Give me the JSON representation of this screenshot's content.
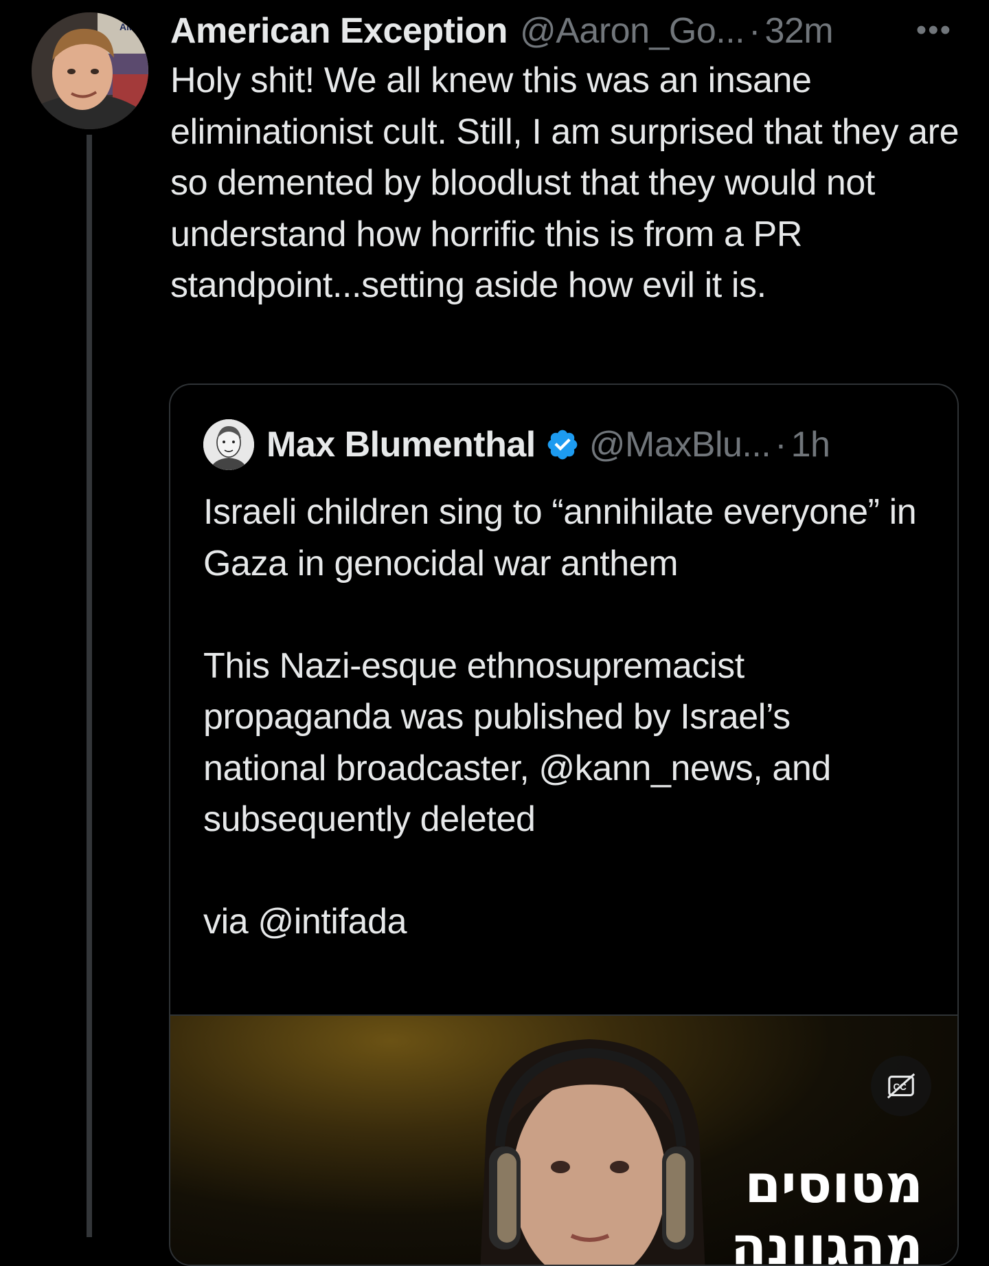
{
  "post": {
    "author_name": "American Exception",
    "author_handle": "@Aaron_Go...",
    "separator": "·",
    "timestamp": "32m",
    "more_label": "•••",
    "text": "Holy shit! We all knew this was an insane eliminationist cult. Still, I am surprised that they are so demented by bloodlust that they would not understand how horrific this is from a PR standpoint...setting aside how evil it is.",
    "avatar_sign_text": "AME EXCEPT"
  },
  "quote": {
    "author_name": "Max Blumenthal",
    "author_handle": "@MaxBlu...",
    "separator": "·",
    "timestamp": "1h",
    "verified_icon": "verified-badge-icon",
    "text": "Israeli children sing to “annihilate everyone” in Gaza in genocidal war anthem\n\nThis Nazi-esque ethnosupremacist propaganda was published by Israel’s national broadcaster, @kann_news, and subsequently deleted\n\nvia @intifada",
    "media": {
      "caption_overlay": "מטוסים\nמהגוונה",
      "cc_icon": "closed-captions-off-icon"
    }
  },
  "colors": {
    "background": "#000000",
    "text_primary": "#e7e9ea",
    "text_secondary": "#71767b",
    "border": "#2f3336",
    "verified_blue": "#1d9bf0"
  }
}
